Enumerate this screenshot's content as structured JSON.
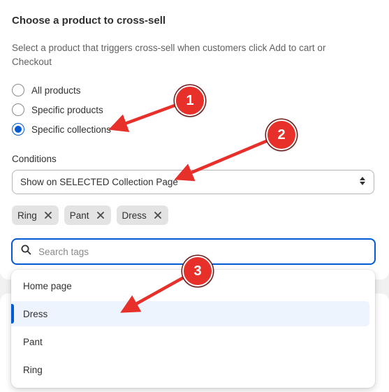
{
  "section": {
    "title": "Choose a product to cross-sell",
    "description": "Select a product that triggers cross-sell when customers click Add to cart or Checkout"
  },
  "trigger_options": [
    {
      "label": "All products",
      "selected": false
    },
    {
      "label": "Specific products",
      "selected": false
    },
    {
      "label": "Specific collections",
      "selected": true
    }
  ],
  "conditions": {
    "label": "Conditions",
    "selected_value": "Show on SELECTED Collection Page"
  },
  "tags": [
    "Ring",
    "Pant",
    "Dress"
  ],
  "search": {
    "placeholder": "Search tags",
    "value": ""
  },
  "dropdown": {
    "items": [
      {
        "label": "Home page",
        "highlighted": false
      },
      {
        "label": "Dress",
        "highlighted": true
      },
      {
        "label": "Pant",
        "highlighted": false
      },
      {
        "label": "Ring",
        "highlighted": false
      }
    ]
  },
  "annotations": {
    "badges": [
      "1",
      "2",
      "3"
    ],
    "color": "#e8302a"
  },
  "colors": {
    "accent": "#005bd3",
    "highlight_bg": "#eef4fd"
  }
}
